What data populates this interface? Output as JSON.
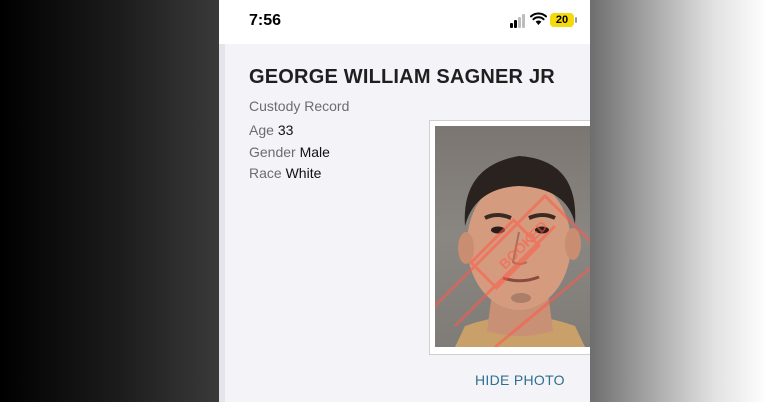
{
  "status_bar": {
    "time": "7:56",
    "battery": "20",
    "icons": [
      "signal-icon",
      "wifi-icon",
      "battery-icon"
    ]
  },
  "record": {
    "name": "GEORGE WILLIAM SAGNER JR",
    "type": "Custody Record",
    "age_label": "Age",
    "age_value": "33",
    "gender_label": "Gender",
    "gender_value": "Male",
    "race_label": "Race",
    "race_value": "White"
  },
  "photo": {
    "watermark": "BOOKED"
  },
  "actions": {
    "hide_photo": "HIDE PHOTO"
  },
  "colors": {
    "link": "#2f6f8f",
    "battery": "#f5d90a",
    "background": "#f3f3f8"
  }
}
